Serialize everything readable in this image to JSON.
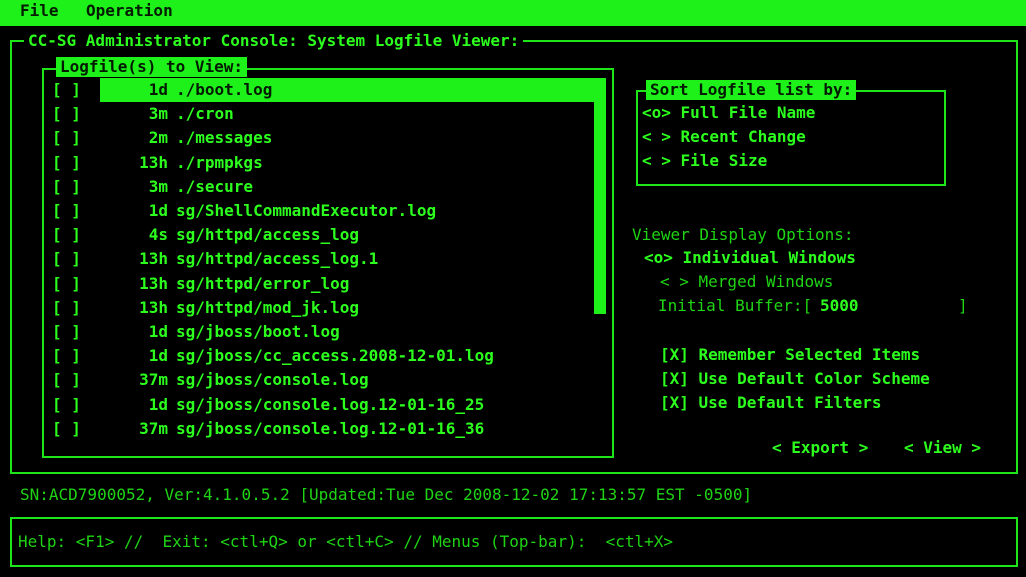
{
  "menu": {
    "file": "File",
    "operation": "Operation"
  },
  "console_title": "CC-SG Administrator Console: System Logfile Viewer:",
  "logfiles": {
    "title": "Logfile(s) to View:",
    "items": [
      {
        "check": "[ ]",
        "age": "1d",
        "name": "./boot.log"
      },
      {
        "check": "[ ]",
        "age": "3m",
        "name": "./cron"
      },
      {
        "check": "[ ]",
        "age": "2m",
        "name": "./messages"
      },
      {
        "check": "[ ]",
        "age": "13h",
        "name": "./rpmpkgs"
      },
      {
        "check": "[ ]",
        "age": "3m",
        "name": "./secure"
      },
      {
        "check": "[ ]",
        "age": "1d",
        "name": "sg/ShellCommandExecutor.log"
      },
      {
        "check": "[ ]",
        "age": "4s",
        "name": "sg/httpd/access_log"
      },
      {
        "check": "[ ]",
        "age": "13h",
        "name": "sg/httpd/access_log.1"
      },
      {
        "check": "[ ]",
        "age": "13h",
        "name": "sg/httpd/error_log"
      },
      {
        "check": "[ ]",
        "age": "13h",
        "name": "sg/httpd/mod_jk.log"
      },
      {
        "check": "[ ]",
        "age": "1d",
        "name": "sg/jboss/boot.log"
      },
      {
        "check": "[ ]",
        "age": "1d",
        "name": "sg/jboss/cc_access.2008-12-01.log"
      },
      {
        "check": "[ ]",
        "age": "37m",
        "name": "sg/jboss/console.log"
      },
      {
        "check": "[ ]",
        "age": "1d",
        "name": "sg/jboss/console.log.12-01-16_25"
      },
      {
        "check": "[ ]",
        "age": "37m",
        "name": "sg/jboss/console.log.12-01-16_36"
      }
    ]
  },
  "sort": {
    "title": "Sort Logfile list by:",
    "options": [
      "<o> Full File Name",
      "< > Recent Change",
      "< > File Size"
    ]
  },
  "display": {
    "title": "Viewer Display Options:",
    "individual": "<o> Individual Windows",
    "merged": "< > Merged Windows",
    "buffer_label": "Initial Buffer:[",
    "buffer_value": "5000",
    "buffer_end": "]"
  },
  "checks": {
    "remember": "[X] Remember Selected Items",
    "color": "[X] Use Default Color Scheme",
    "filters": "[X] Use Default Filters"
  },
  "buttons": {
    "export": "< Export >",
    "view": "< View >"
  },
  "status": "SN:ACD7900052, Ver:4.1.0.5.2 [Updated:Tue Dec 2008-12-02 17:13:57 EST -0500]",
  "help": "Help: <F1> //  Exit: <ctl+Q> or <ctl+C> // Menus (Top-bar):  <ctl+X>"
}
